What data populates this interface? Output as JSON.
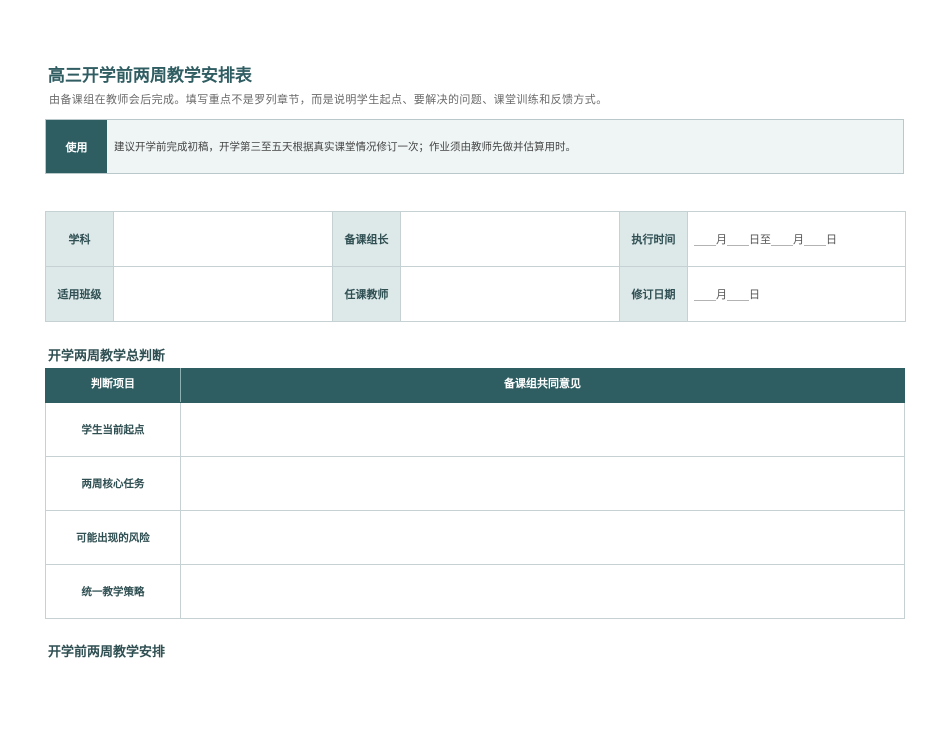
{
  "header": {
    "title": "高三开学前两周教学安排表",
    "subtitle": "由备课组在教师会后完成。填写重点不是罗列章节，而是说明学生起点、要解决的问题、课堂训练和反馈方式。"
  },
  "notice": {
    "tag": "使用",
    "text": "建议开学前完成初稿，开学第三至五天根据真实课堂情况修订一次；作业须由教师先做并估算用时。"
  },
  "info": {
    "rows": [
      [
        {
          "label": "学科",
          "value": ""
        },
        {
          "label": "备课组长",
          "value": ""
        },
        {
          "label": "执行时间",
          "value": "____月____日至____月____日"
        }
      ],
      [
        {
          "label": "适用班级",
          "value": ""
        },
        {
          "label": "任课教师",
          "value": ""
        },
        {
          "label": "修订日期",
          "value": "____月____日"
        }
      ]
    ]
  },
  "judgement": {
    "section_title": "开学两周教学总判断",
    "headers": [
      "判断项目",
      "备课组共同意见"
    ],
    "items": [
      "学生当前起点",
      "两周核心任务",
      "可能出现的风险",
      "统一教学策略"
    ]
  },
  "schedule": {
    "section_title": "开学前两周教学安排"
  },
  "colors": {
    "accent": "#2e5e62",
    "label_bg": "#dde8e9",
    "notice_bg": "#eff5f5",
    "border": "#c5d1d3"
  }
}
